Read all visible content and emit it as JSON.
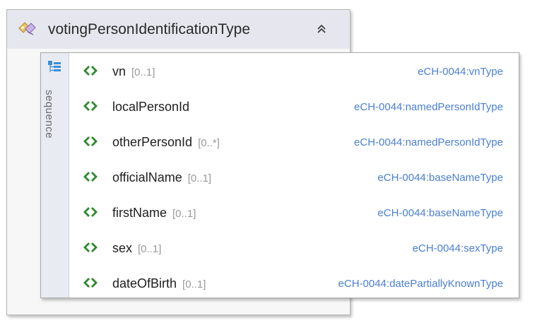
{
  "complex_type": {
    "name": "votingPersonIdentificationType",
    "icon": "complex-type-icon",
    "collapse_icon": "double-chevron-up-icon"
  },
  "sequence": {
    "label": "sequence",
    "icon": "sequence-icon",
    "elements": [
      {
        "name": "vn",
        "occurrence": "[0..1]",
        "type": "eCH-0044:vnType"
      },
      {
        "name": "localPersonId",
        "occurrence": "",
        "type": "eCH-0044:namedPersonIdType"
      },
      {
        "name": "otherPersonId",
        "occurrence": "[0..*]",
        "type": "eCH-0044:namedPersonIdType"
      },
      {
        "name": "officialName",
        "occurrence": "[0..1]",
        "type": "eCH-0044:baseNameType"
      },
      {
        "name": "firstName",
        "occurrence": "[0..1]",
        "type": "eCH-0044:baseNameType"
      },
      {
        "name": "sex",
        "occurrence": "[0..1]",
        "type": "eCH-0044:sexType"
      },
      {
        "name": "dateOfBirth",
        "occurrence": "[0..1]",
        "type": "eCH-0044:datePartiallyKnownType"
      }
    ]
  },
  "colors": {
    "element_icon": "#2e8b2e",
    "type_link": "#4a7fd0",
    "header_bg": "#e6e7ee"
  }
}
